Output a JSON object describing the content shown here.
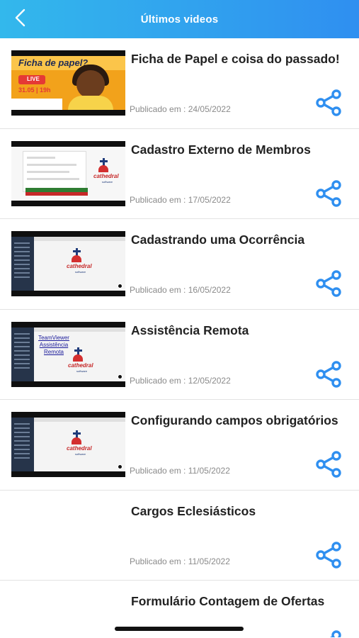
{
  "header": {
    "title": "Últimos videos",
    "back_icon": "chevron-left-icon",
    "gradient": [
      "#33b8ec",
      "#2f8ff0"
    ]
  },
  "colors": {
    "share_icon": "#2f8ff0",
    "title": "#222222",
    "date": "#8a8a8a"
  },
  "videos": [
    {
      "title": "Ficha de Papel e coisa do passado!",
      "date": "Publicado em : 24/05/2022",
      "thumb": {
        "heading": "Ficha de papel?",
        "live": "LIVE",
        "when": "31.05 | 19h"
      }
    },
    {
      "title": "Cadastro Externo de Membros",
      "date": "Publicado em : 17/05/2022",
      "thumb": {
        "logo": "cathedral",
        "logo_sub": "software"
      }
    },
    {
      "title": "Cadastrando uma Ocorrência",
      "date": "Publicado em : 16/05/2022",
      "thumb": {
        "logo": "cathedral",
        "logo_sub": "software"
      }
    },
    {
      "title": "Assistência Remota",
      "date": "Publicado em : 12/05/2022",
      "thumb": {
        "overlay_line1": "TeamViewer",
        "overlay_line2": "Assistência",
        "overlay_line3": "Remota",
        "logo": "cathedral",
        "logo_sub": "software"
      }
    },
    {
      "title": "Configurando campos obrigatórios",
      "date": "Publicado em : 11/05/2022",
      "thumb": {
        "logo": "cathedral",
        "logo_sub": "software"
      }
    },
    {
      "title": "Cargos Eclesiásticos",
      "date": "Publicado em : 11/05/2022"
    },
    {
      "title": "Formulário Contagem de Ofertas"
    }
  ]
}
